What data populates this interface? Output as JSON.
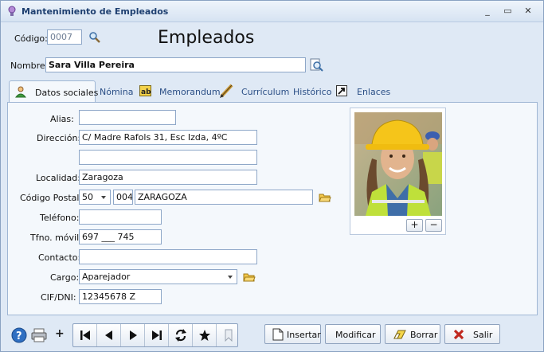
{
  "window": {
    "title": "Mantenimiento de Empleados",
    "controls": [
      "_",
      "▭",
      "✕"
    ]
  },
  "header": {
    "codigo_label": "Código:",
    "codigo_value": "0007",
    "page_title": "Empleados",
    "nombre_label": "Nombre:",
    "nombre_value": "Sara Villa Pereira"
  },
  "tabs": [
    {
      "label": "Datos sociales",
      "active": true,
      "icon": "person-icon"
    },
    {
      "label": "Nómina",
      "active": false,
      "icon": ""
    },
    {
      "label": "Memorandum",
      "active": false,
      "icon": "ab-text-icon"
    },
    {
      "label": "Currículum",
      "active": false,
      "icon": "pen-icon"
    },
    {
      "label": "Histórico",
      "active": false,
      "icon": ""
    },
    {
      "label": "Enlaces",
      "active": false,
      "icon": "shortcut-icon"
    }
  ],
  "form": {
    "alias": {
      "label": "Alias:",
      "value": ""
    },
    "direccion": {
      "label": "Dirección:",
      "value": "C/ Madre Rafols 31, Esc Izda, 4ºC",
      "value2": ""
    },
    "localidad": {
      "label": "Localidad:",
      "value": "Zaragoza"
    },
    "codigo_postal": {
      "label": "Código Postal:",
      "provincia": "50",
      "codigo": "004",
      "poblacion": "ZARAGOZA"
    },
    "telefono": {
      "label": "Teléfono:",
      "value": ""
    },
    "movil": {
      "label": "Tfno. móvil:",
      "value": "697 ___ 745"
    },
    "contacto": {
      "label": "Contacto:",
      "value": ""
    },
    "cargo": {
      "label": "Cargo:",
      "value": "Aparejador"
    },
    "cif": {
      "label": "CIF/DNI:",
      "value": "12345678 Z"
    }
  },
  "photo": {
    "add_label": "+",
    "remove_label": "−"
  },
  "toolbar": {
    "add_label": "+",
    "insert_label": "Insertar",
    "modify_label": "Modificar",
    "delete_label": "Borrar",
    "exit_label": "Salir"
  },
  "colors": {
    "accent": "#2b4f86",
    "background": "#dfe9f5",
    "panel": "#f4f8fc",
    "exit_red": "#c0281f"
  }
}
